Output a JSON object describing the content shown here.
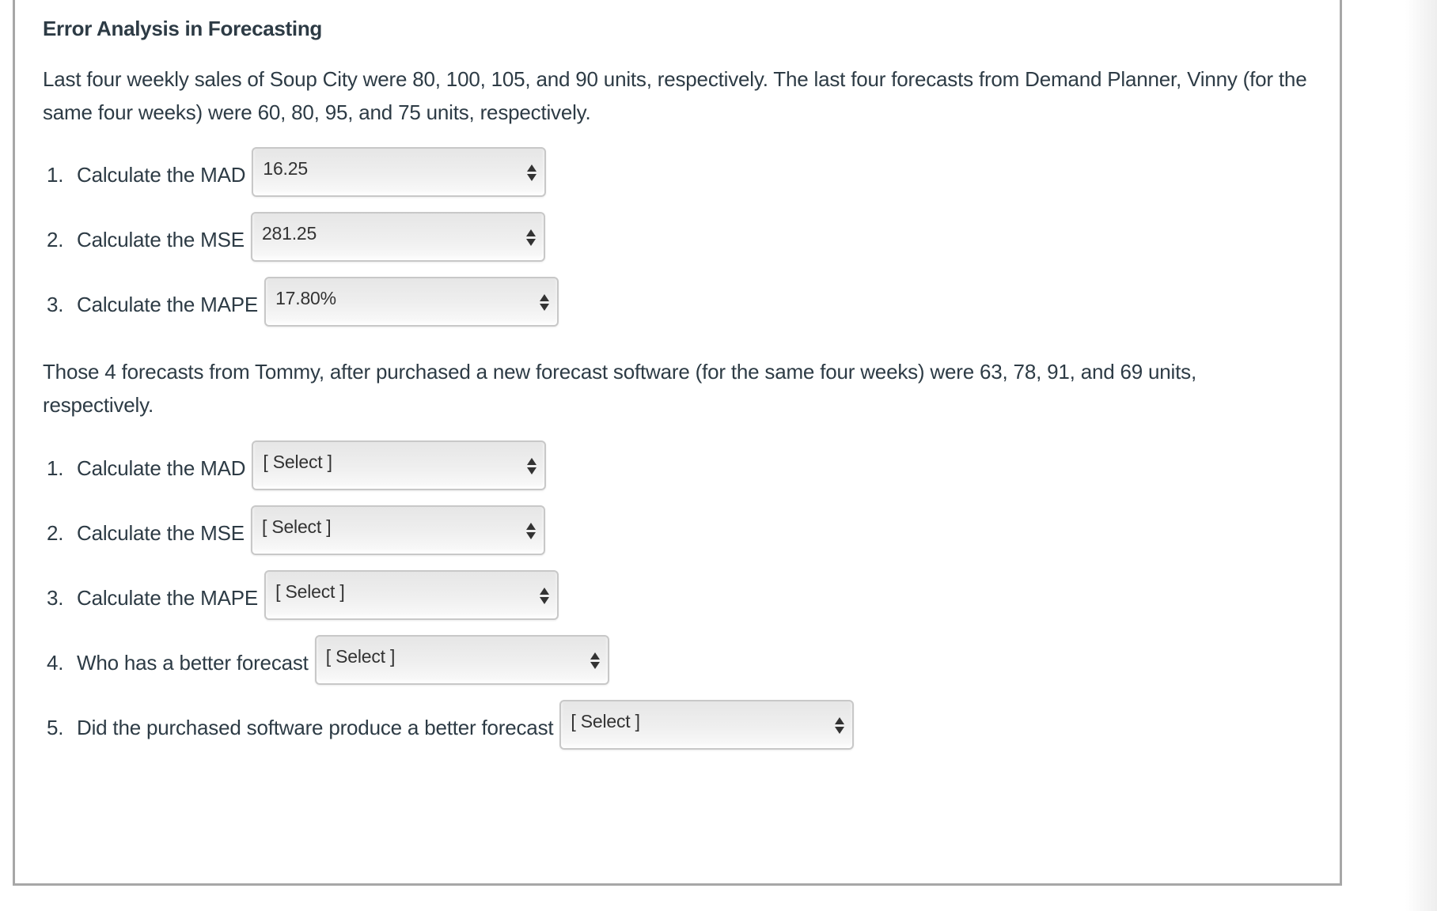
{
  "question": {
    "title": "Error Analysis in Forecasting",
    "paragraph_1": "Last four weekly sales of Soup City were 80, 100, 105, and 90 units, respectively. The last four forecasts from Demand Planner, Vinny (for the same four weeks) were 60, 80, 95, and 75 units, respectively.",
    "paragraph_2": "Those 4 forecasts from Tommy, after purchased a new forecast software (for the same four weeks) were 63, 78, 91, and 69 units, respectively."
  },
  "part_1": {
    "items": [
      {
        "number": "1.",
        "label": "Calculate the MAD",
        "selected": "16.25"
      },
      {
        "number": "2.",
        "label": "Calculate the MSE",
        "selected": "281.25"
      },
      {
        "number": "3.",
        "label": "Calculate the MAPE",
        "selected": "17.80%"
      }
    ]
  },
  "part_2": {
    "items": [
      {
        "number": "1.",
        "label": "Calculate the MAD",
        "selected": "[ Select ]"
      },
      {
        "number": "2.",
        "label": "Calculate the MSE",
        "selected": "[ Select ]"
      },
      {
        "number": "3.",
        "label": "Calculate the MAPE",
        "selected": "[ Select ]"
      },
      {
        "number": "4.",
        "label": "Who has a better forecast",
        "selected": "[ Select ]"
      },
      {
        "number": "5.",
        "label": "Did the purchased software produce a better forecast",
        "selected": "[ Select ]"
      }
    ]
  },
  "icons": {
    "select_arrows": "up-down-sort-arrows"
  },
  "colors": {
    "text": "#2d3b45",
    "card_border": "#a7a7a7",
    "select_border": "#c8c8c8"
  }
}
